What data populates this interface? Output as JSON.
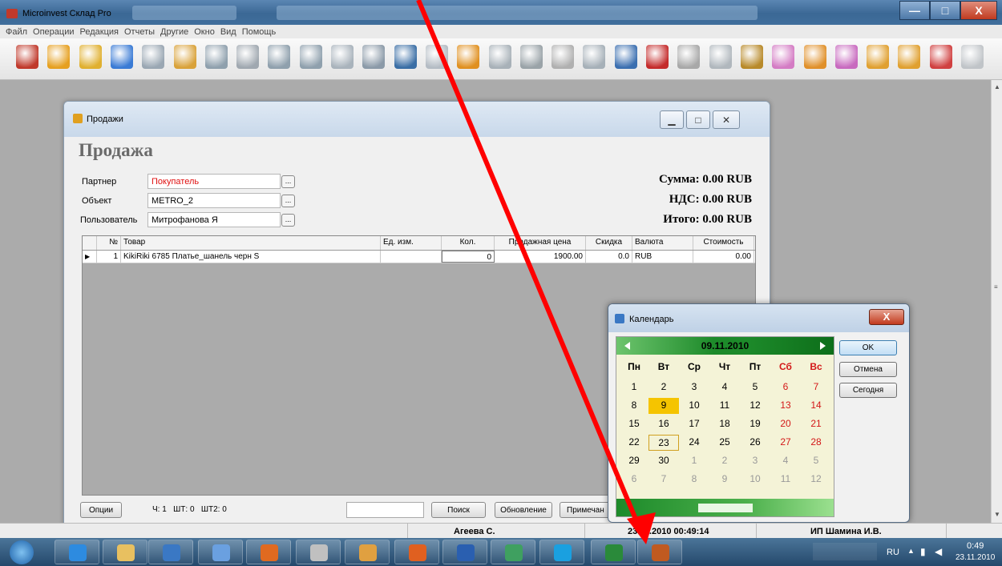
{
  "window": {
    "title": "Microinvest Склад Pro",
    "controls": {
      "minimize": "—",
      "maximize": "□",
      "close": "X"
    }
  },
  "menu": {
    "items": [
      "Файл",
      "Операции",
      "Редакция",
      "Отчеты",
      "Другие",
      "Окно",
      "Вид",
      "Помощь"
    ]
  },
  "toolbar": {
    "icon_names": [
      "exit-icon",
      "sale-icon",
      "delivery-icon",
      "production-icon",
      "transfer-icon",
      "return-icon",
      "refund-icon",
      "document-icon",
      "payment-icon",
      "debt-icon",
      "cash-icon",
      "cashier-icon",
      "monitor-icon",
      "clipboard-icon",
      "order-icon",
      "edit-icon",
      "partner-icon",
      "goods-icon",
      "objects-icon",
      "users-icon",
      "tools-icon",
      "reports-icon",
      "operations-icon",
      "settings-icon",
      "calendar-icon",
      "invoice-icon",
      "calendar2-icon",
      "invoice2-icon",
      "delivery2-icon",
      "refresh-icon",
      "new-doc-icon"
    ]
  },
  "sales": {
    "window_title": "Продажи",
    "heading": "Продажа",
    "partner_label": "Партнер",
    "partner_value": "Покупатель",
    "object_label": "Объект",
    "object_value": "METRO_2",
    "user_label": "Пользователь",
    "user_value": "Митрофанова Я",
    "browse": "...",
    "sum": "Сумма: 0.00 RUB",
    "vat": "НДС: 0.00 RUB",
    "total": "Итого: 0.00 RUB",
    "columns": [
      "№",
      "Товар",
      "Ед. изм.",
      "Кол.",
      "Продажная цена",
      "Скидка",
      "Валюта",
      "Стоимость"
    ],
    "rows": [
      {
        "num": "1",
        "product": "KikiRiki 6785 Платье_шанель черн S",
        "unit": "",
        "qty": "0",
        "price": "1900.00",
        "discount": "0.0",
        "currency": "RUB",
        "cost": "0.00"
      }
    ],
    "options_button": "Опции",
    "counters": "Ч: 1   ШТ: 0   ШТ2: 0",
    "search_value": "",
    "search_button": "Поиск",
    "refresh_button": "Обновление",
    "note_button": "Примечан"
  },
  "calendar": {
    "title": "Календарь",
    "month": "09.11.2010",
    "weekdays": [
      "Пн",
      "Вт",
      "Ср",
      "Чт",
      "Пт",
      "Сб",
      "Вс"
    ],
    "weeks": [
      [
        "1",
        "2",
        "3",
        "4",
        "5",
        "6",
        "7"
      ],
      [
        "8",
        "9",
        "10",
        "11",
        "12",
        "13",
        "14"
      ],
      [
        "15",
        "16",
        "17",
        "18",
        "19",
        "20",
        "21"
      ],
      [
        "22",
        "23",
        "24",
        "25",
        "26",
        "27",
        "28"
      ],
      [
        "29",
        "30",
        "1",
        "2",
        "3",
        "4",
        "5"
      ],
      [
        "6",
        "7",
        "8",
        "9",
        "10",
        "11",
        "12"
      ]
    ],
    "selected_day": "9",
    "current_day": "23",
    "ok": "OK",
    "cancel": "Отмена",
    "today": "Сегодня",
    "accent": "#1d8a2a",
    "highlight": "#f5c400",
    "weekend_color": "#d31818"
  },
  "status": {
    "user": "Агеева С.",
    "datetime": "23.11.2010 00:49:14",
    "company": "ИП Шамина И.В."
  },
  "taskbar": {
    "apps": [
      "ie-icon",
      "explorer-icon",
      "media-icon",
      "paint-icon",
      "mail-icon",
      "unknown-app-icon",
      "outlook-icon",
      "firefox-icon",
      "word-icon",
      "shop-icon",
      "skype-icon",
      "excel-icon",
      "microinvest-icon"
    ],
    "lang": "RU",
    "time": "0:49",
    "date": "23.11.2010"
  },
  "annotation": {
    "type": "red-arrow",
    "color": "#ff0000"
  }
}
